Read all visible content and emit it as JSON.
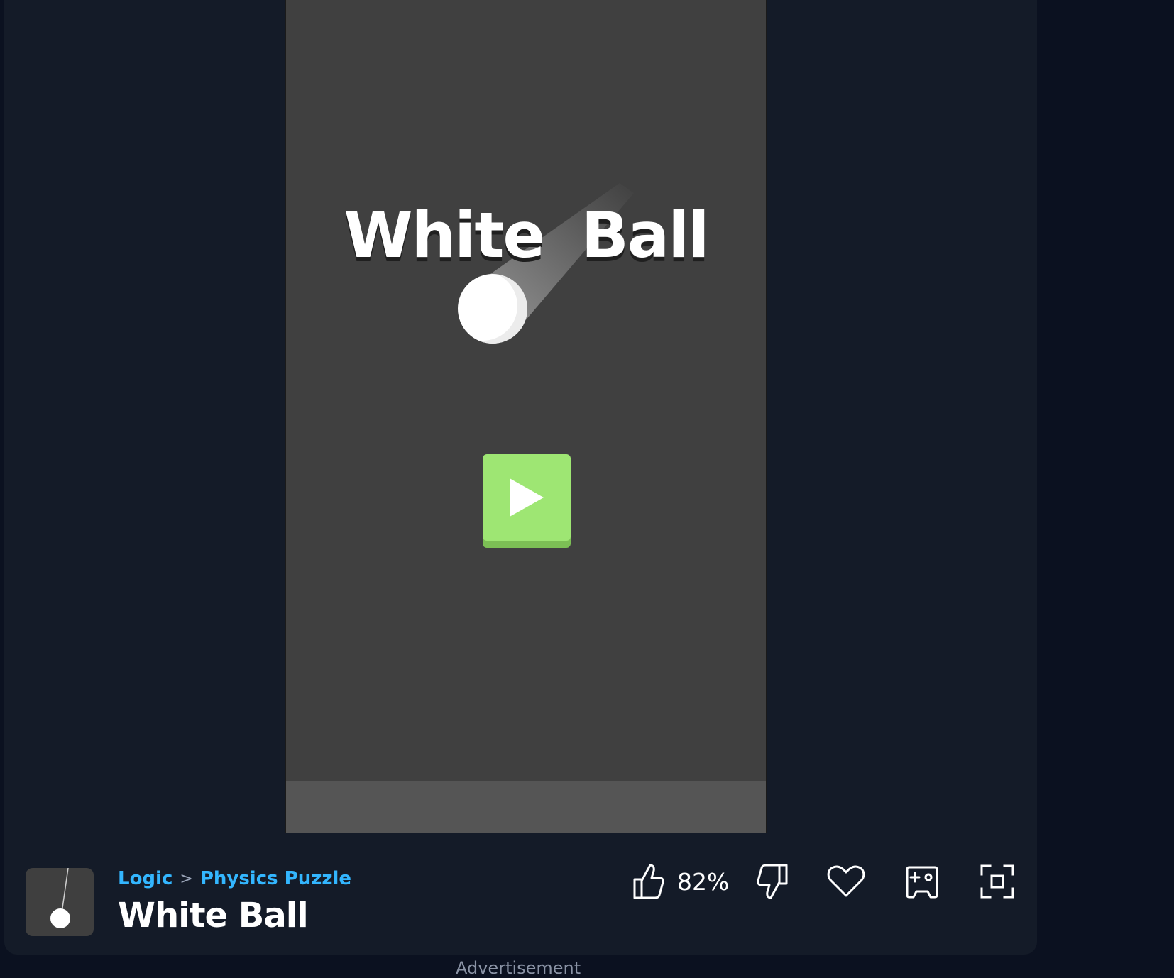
{
  "game": {
    "title": "White Ball",
    "play_label": "Play"
  },
  "breadcrumb": {
    "category": "Logic",
    "separator": ">",
    "subcategory": "Physics Puzzle"
  },
  "page_title": "White Ball",
  "actions": {
    "like_percent": "82%"
  },
  "advertisement_label": "Advertisement",
  "icons": [
    "thumbs-up-icon",
    "thumbs-down-icon",
    "heart-icon",
    "add-to-playlist-icon",
    "fullscreen-icon",
    "play-icon"
  ],
  "colors": {
    "page_bg": "#0b1120",
    "panel_bg": "#141b28",
    "game_bg": "#404040",
    "play_button": "#9ee673",
    "breadcrumb_link": "#33b6ff"
  }
}
